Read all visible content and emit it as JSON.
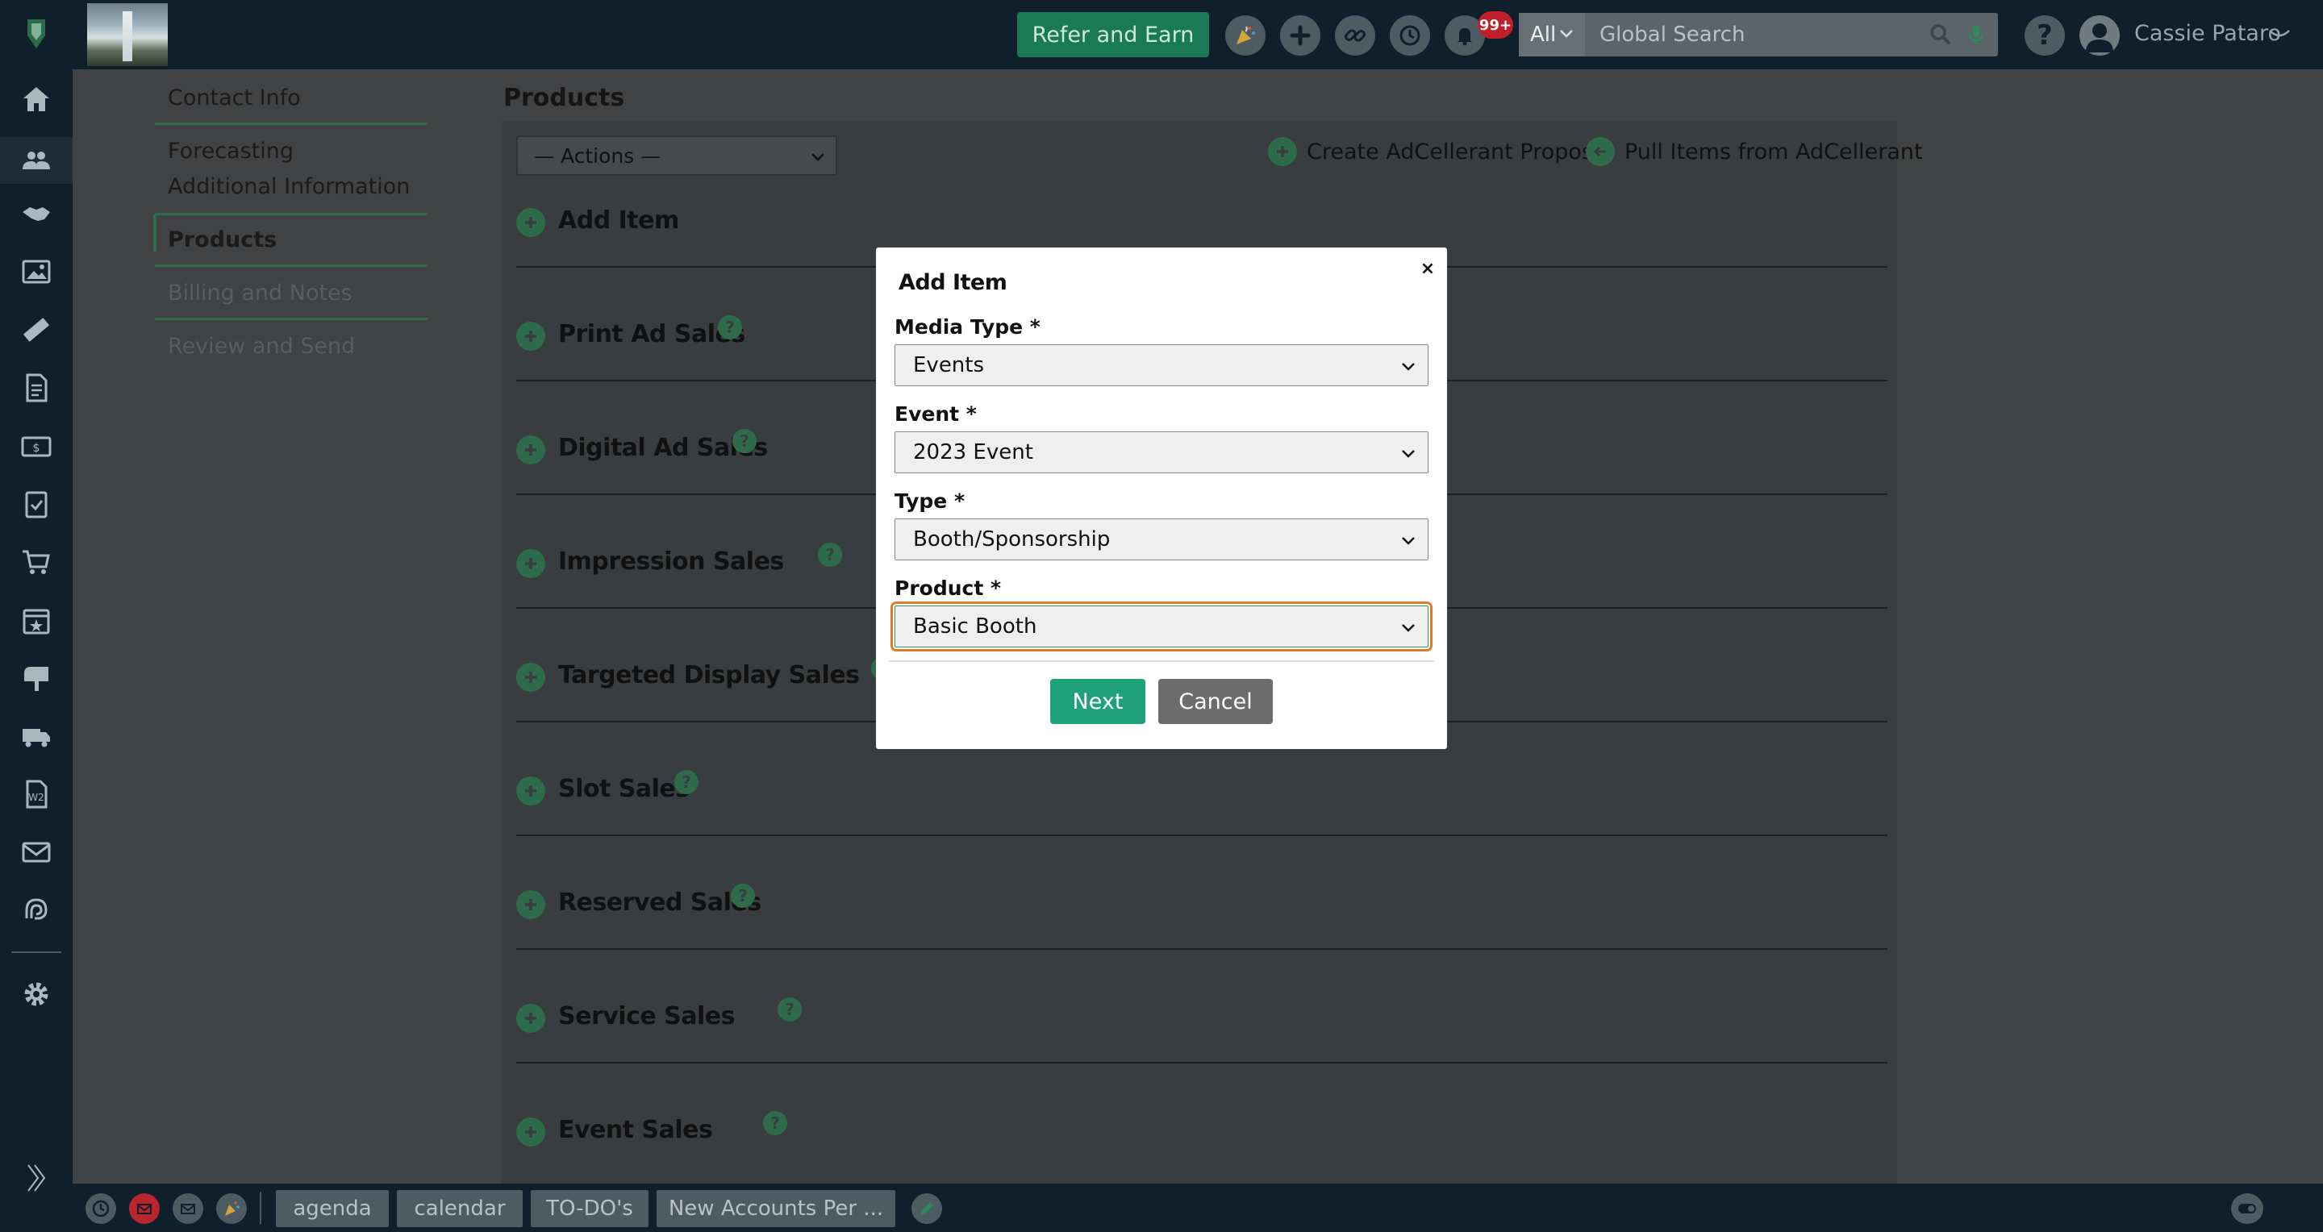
{
  "topbar": {
    "refer_label": "Refer and Earn",
    "notification_count": "99+",
    "search_scope": "All",
    "search_placeholder": "Global Search",
    "help_label": "?",
    "user_name": "Cassie Pataro"
  },
  "subnav": {
    "items": [
      {
        "label": "Contact Info"
      },
      {
        "label": "Forecasting"
      },
      {
        "label": "Additional Information"
      },
      {
        "label": "Products"
      },
      {
        "label": "Billing and Notes"
      },
      {
        "label": "Review and Send"
      }
    ]
  },
  "main": {
    "section_title": "Products",
    "actions_select": "— Actions —",
    "create_proposal": "Create AdCellerant Proposal",
    "pull_items": "Pull Items from AdCellerant",
    "add_item": "Add Item",
    "sales": [
      {
        "label": "Print Ad Sales",
        "help": "?"
      },
      {
        "label": "Digital Ad Sales",
        "help": "?"
      },
      {
        "label": "Impression Sales",
        "help": "?"
      },
      {
        "label": "Targeted Display Sales",
        "help": "?"
      },
      {
        "label": "Slot Sales",
        "help": "?"
      },
      {
        "label": "Reserved Sales",
        "help": "?"
      },
      {
        "label": "Service Sales",
        "help": "?"
      },
      {
        "label": "Event Sales",
        "help": "?"
      }
    ]
  },
  "bottombar": {
    "tabs": [
      "agenda",
      "calendar",
      "TO-DO's",
      "New Accounts Per ..."
    ]
  },
  "modal": {
    "title": "Add Item",
    "close": "×",
    "fields": [
      {
        "label": "Media Type *",
        "value": "Events"
      },
      {
        "label": "Event *",
        "value": "2023 Event"
      },
      {
        "label": "Type *",
        "value": "Booth/Sponsorship"
      },
      {
        "label": "Product *",
        "value": "Basic Booth"
      }
    ],
    "next_label": "Next",
    "cancel_label": "Cancel"
  },
  "colors": {
    "accent_green": "#2d6b4a",
    "refer_green": "#1a7a55",
    "next_green": "#1fa27a",
    "focus_orange": "#e07b2c",
    "nav_bg": "#0f1f2b",
    "badge_red": "#c0202a"
  }
}
